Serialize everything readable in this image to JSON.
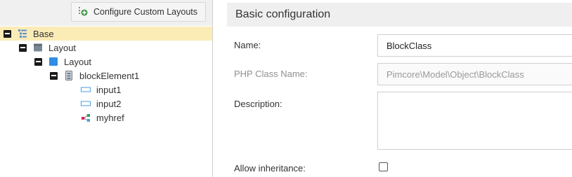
{
  "left_toolbar": {
    "configure_button_label": "Configure Custom Layouts"
  },
  "tree": {
    "nodes": [
      {
        "label": "Base",
        "icon": "list-tree-icon",
        "selected": true
      },
      {
        "label": "Layout",
        "icon": "panel-icon"
      },
      {
        "label": "Layout",
        "icon": "region-icon"
      },
      {
        "label": "blockElement1",
        "icon": "block-icon"
      },
      {
        "label": "input1",
        "icon": "input-icon"
      },
      {
        "label": "input2",
        "icon": "input-icon"
      },
      {
        "label": "myhref",
        "icon": "href-icon"
      }
    ]
  },
  "panel": {
    "title": "Basic configuration",
    "fields": {
      "name_label": "Name:",
      "name_value": "BlockClass",
      "php_class_label": "PHP Class Name:",
      "php_class_value": "Pimcore\\Model\\Object\\BlockClass",
      "description_label": "Description:",
      "description_value": "",
      "allow_inheritance_label": "Allow inheritance:",
      "allow_inheritance_checked": false
    }
  },
  "colors": {
    "selected_row": "#fbebb5",
    "panel_header": "#efefef",
    "toolbar_bg": "#f0f0f0",
    "add_icon_green": "#3c9a3c",
    "input_icon_blue": "#4a9ee6",
    "href_icon_red": "#e0245e"
  }
}
